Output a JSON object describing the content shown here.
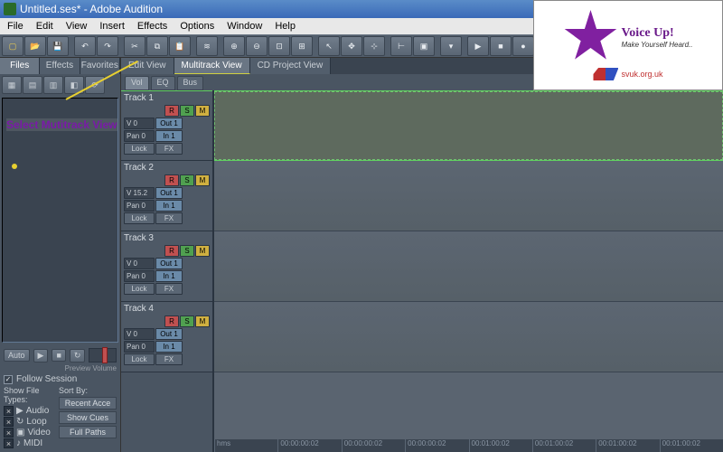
{
  "window": {
    "title": "Untitled.ses* - Adobe Audition"
  },
  "menu": [
    "File",
    "Edit",
    "View",
    "Insert",
    "Effects",
    "Options",
    "Window",
    "Help"
  ],
  "toolbar_icons": [
    "new",
    "open",
    "save",
    "",
    "undo",
    "redo",
    "",
    "cut",
    "copy",
    "paste",
    "",
    "mix",
    "",
    "zin",
    "zout",
    "zsel",
    "zall",
    "",
    "ptr",
    "mov",
    "hyb",
    "",
    "snp",
    "grp",
    "",
    "mrk",
    "",
    "play",
    "stop",
    "rec",
    "",
    "lvl",
    "dB",
    "↕",
    "",
    "?",
    "wet",
    "FX",
    "cfg"
  ],
  "left_panel": {
    "tabs": [
      "Files",
      "Effects",
      "Favorites"
    ],
    "auto": "Auto",
    "preview_label": "Preview Volume",
    "follow": "Follow Session",
    "show_types_label": "Show File Types:",
    "sort_label": "Sort By:",
    "types": [
      "Audio",
      "Loop",
      "Video",
      "MIDI"
    ],
    "sort_dropdown": "Recent Acce",
    "btn_cues": "Show Cues",
    "btn_paths": "Full Paths"
  },
  "annotation": {
    "text": "Select Mutitrack View"
  },
  "view_tabs": [
    "Edit View",
    "Multitrack View",
    "CD Project View"
  ],
  "sub_tabs": [
    "Vol",
    "EQ",
    "Bus"
  ],
  "tracks": [
    {
      "name": "Track 1",
      "vol": "V 0",
      "pan": "Pan 0",
      "out": "Out 1",
      "in": "In 1"
    },
    {
      "name": "Track 2",
      "vol": "V 15.2",
      "pan": "Pan 0",
      "out": "Out 1",
      "in": "In 1"
    },
    {
      "name": "Track 3",
      "vol": "V 0",
      "pan": "Pan 0",
      "out": "Out 1",
      "in": "In 1"
    },
    {
      "name": "Track 4",
      "vol": "V 0",
      "pan": "Pan 0",
      "out": "Out 1",
      "in": "In 1"
    }
  ],
  "track_btn": {
    "r": "R",
    "s": "S",
    "m": "M",
    "lock": "Lock",
    "fx": "FX"
  },
  "timeline": [
    "hms",
    "00:00:00:02",
    "00:00:00:02",
    "00:00:00:02",
    "00:01:00:02",
    "00:01:00:02",
    "00:01:00:02",
    "00:01:00:02"
  ],
  "logo": {
    "main": "Voice Up!",
    "sub": "Make Yourself Heard..",
    "url": "svuk.org.uk"
  }
}
